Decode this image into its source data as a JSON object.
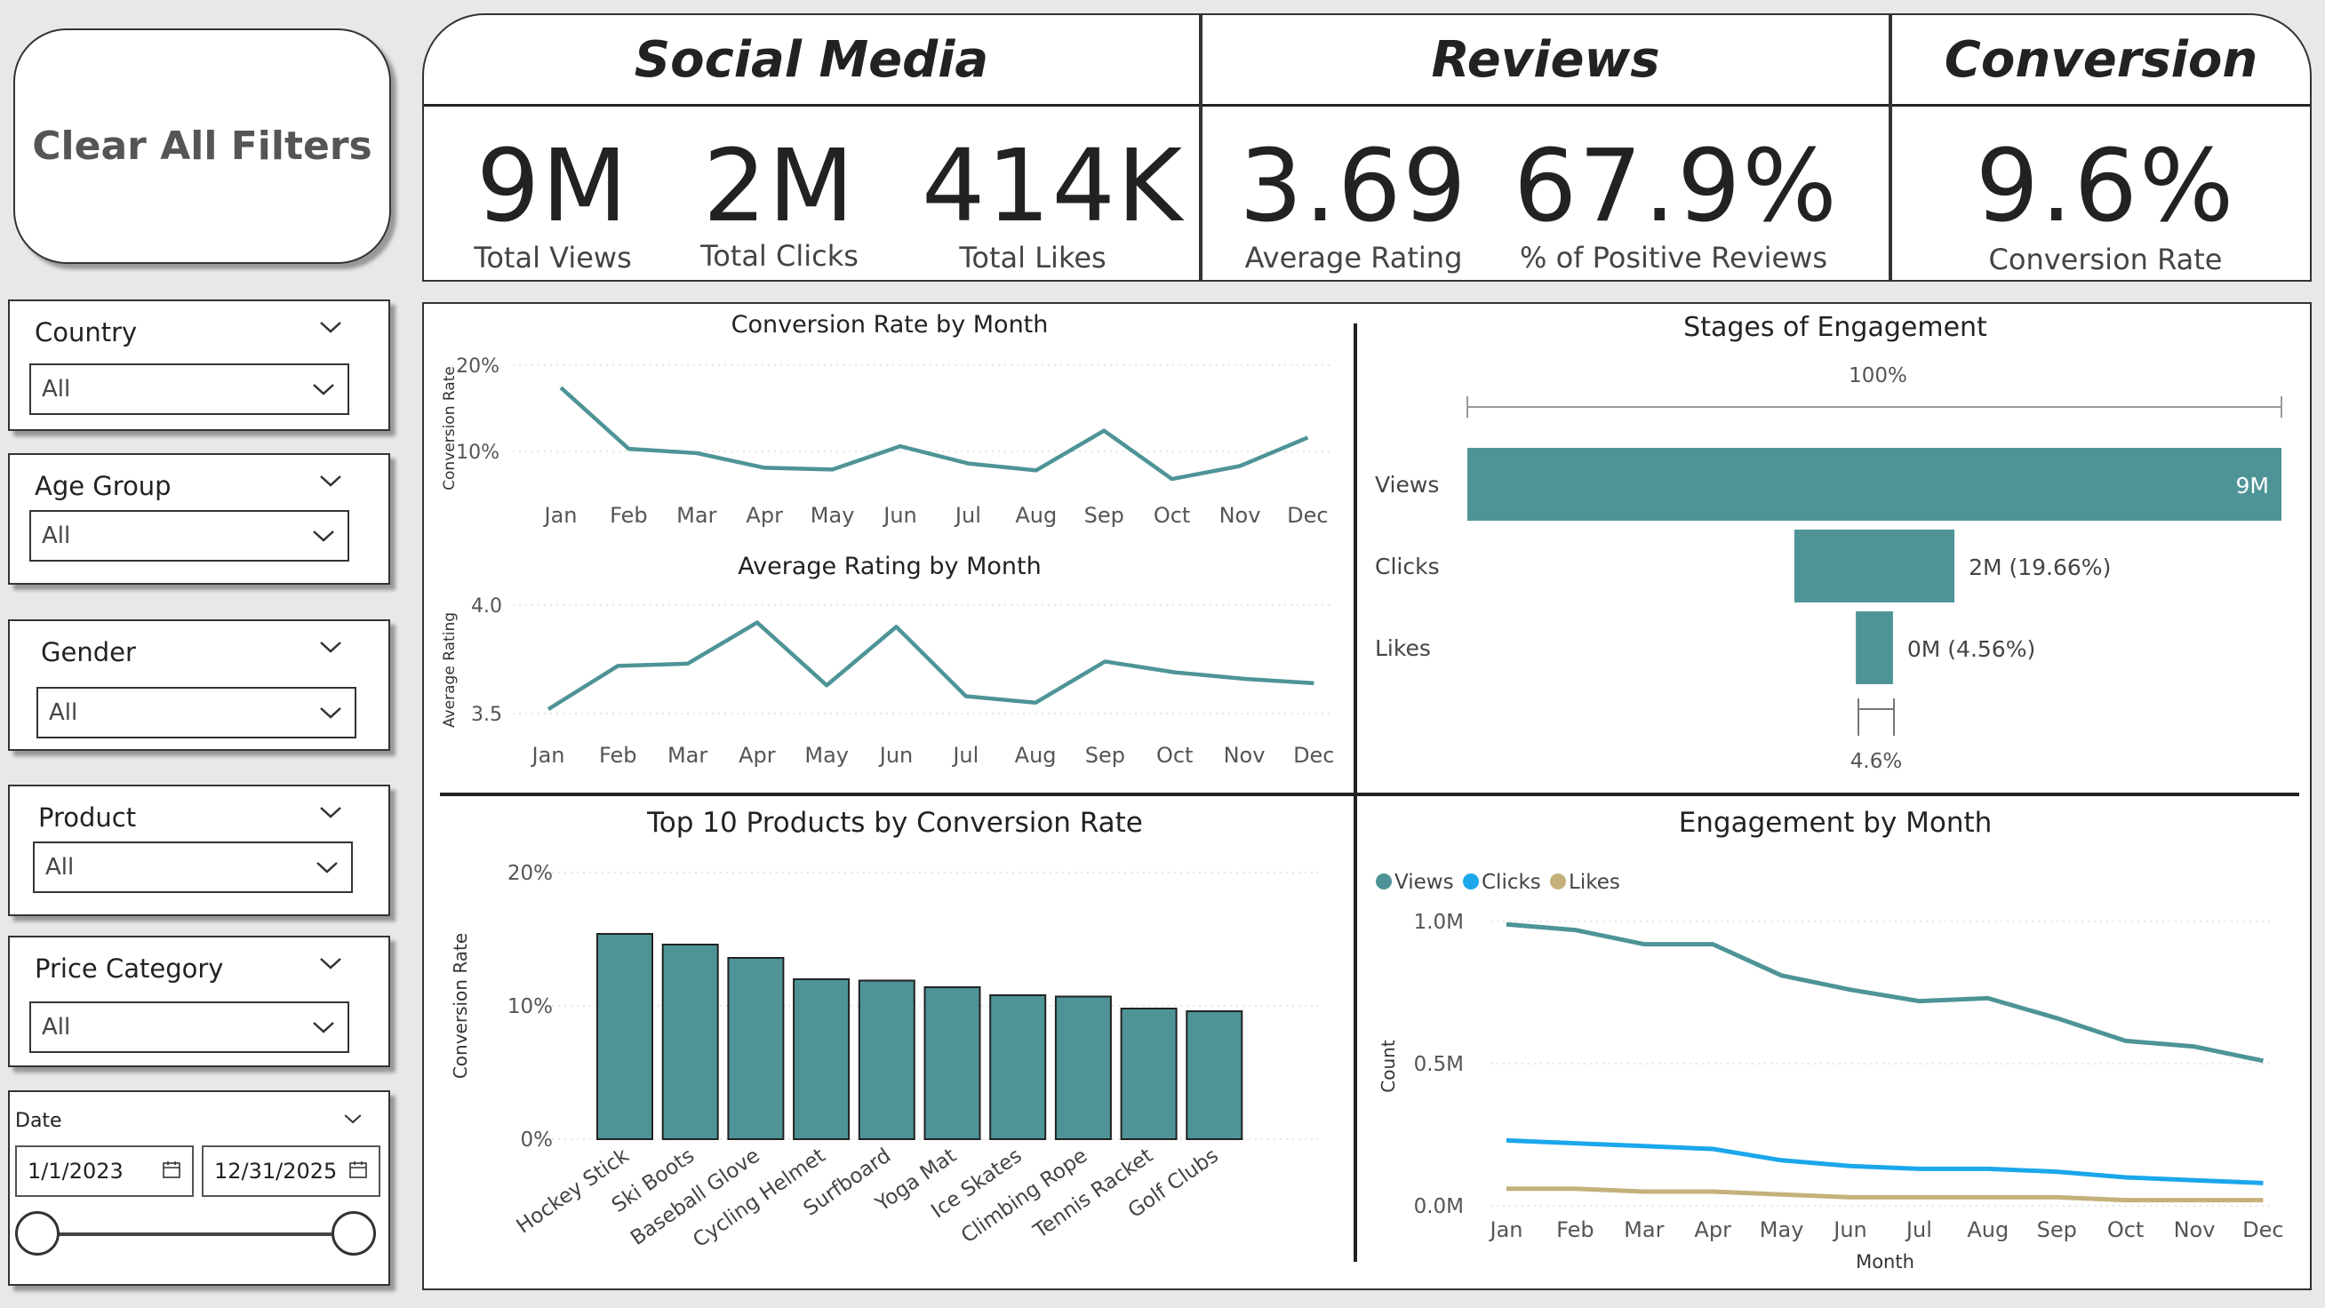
{
  "clear_button": {
    "label": "Clear All Filters"
  },
  "slicers": [
    {
      "title": "Country",
      "value": "All"
    },
    {
      "title": "Age Group",
      "value": "All"
    },
    {
      "title": "Gender",
      "value": "All"
    },
    {
      "title": "Product",
      "value": "All"
    },
    {
      "title": "Price Category",
      "value": "All"
    }
  ],
  "date_slicer": {
    "title": "Date",
    "start": "1/1/2023",
    "end": "12/31/2025"
  },
  "kpi": {
    "social_media": {
      "title": "Social Media",
      "items": [
        {
          "value": "9M",
          "label": "Total Views"
        },
        {
          "value": "2M",
          "label": "Total Clicks"
        },
        {
          "value": "414K",
          "label": "Total Likes"
        }
      ]
    },
    "reviews": {
      "title": "Reviews",
      "items": [
        {
          "value": "3.69",
          "label": "Average Rating"
        },
        {
          "value": "67.9%",
          "label": "% of Positive Reviews"
        }
      ]
    },
    "conversion": {
      "title": "Conversion",
      "items": [
        {
          "value": "9.6%",
          "label": "Conversion Rate"
        }
      ]
    }
  },
  "colors": {
    "teal": "#4e9497",
    "blue": "#1aa7ec",
    "tan": "#c4b07a"
  },
  "chart_data": [
    {
      "type": "line",
      "title": "Conversion Rate by Month",
      "ylabel": "Conversion Rate",
      "x": [
        "Jan",
        "Feb",
        "Mar",
        "Apr",
        "May",
        "Jun",
        "Jul",
        "Aug",
        "Sep",
        "Oct",
        "Nov",
        "Dec"
      ],
      "ticks": [
        "10%",
        "20%"
      ],
      "ylim": [
        0,
        20
      ],
      "values": [
        17.4,
        10.3,
        9.8,
        8.1,
        7.9,
        10.6,
        8.6,
        7.8,
        12.4,
        6.8,
        8.3,
        11.6
      ],
      "grid": true
    },
    {
      "type": "line",
      "title": "Average Rating by Month",
      "ylabel": "Average Rating",
      "x": [
        "Jan",
        "Feb",
        "Mar",
        "Apr",
        "May",
        "Jun",
        "Jul",
        "Aug",
        "Sep",
        "Oct",
        "Nov",
        "Dec"
      ],
      "ticks": [
        "3.5",
        "4.0"
      ],
      "ylim": [
        3.5,
        4.0
      ],
      "values": [
        3.52,
        3.72,
        3.73,
        3.92,
        3.63,
        3.9,
        3.58,
        3.55,
        3.74,
        3.69,
        3.66,
        3.64
      ],
      "grid": true
    },
    {
      "type": "bar",
      "title": "Stages of Engagement",
      "top_label": "100%",
      "bottom_label": "4.6%",
      "categories": [
        "Views",
        "Clicks",
        "Likes"
      ],
      "values": [
        9,
        1.77,
        0.41
      ],
      "data_labels": [
        "9M",
        "2M (19.66%)",
        "0M (4.56%)"
      ]
    },
    {
      "type": "bar",
      "title": "Top 10 Products by Conversion Rate",
      "ylabel": "Conversion Rate",
      "ticks": [
        "0%",
        "10%",
        "20%"
      ],
      "ylim": [
        0,
        20
      ],
      "categories": [
        "Hockey Stick",
        "Ski Boots",
        "Baseball Glove",
        "Cycling Helmet",
        "Surfboard",
        "Yoga Mat",
        "Ice Skates",
        "Climbing Rope",
        "Tennis Racket",
        "Golf Clubs"
      ],
      "values": [
        15.4,
        14.6,
        13.6,
        12.0,
        11.9,
        11.4,
        10.8,
        10.7,
        9.8,
        9.6
      ],
      "grid": true
    },
    {
      "type": "line",
      "title": "Engagement by Month",
      "xlabel": "Month",
      "ylabel": "Count",
      "x": [
        "Jan",
        "Feb",
        "Mar",
        "Apr",
        "May",
        "Jun",
        "Jul",
        "Aug",
        "Sep",
        "Oct",
        "Nov",
        "Dec"
      ],
      "ticks": [
        "0.0M",
        "0.5M",
        "1.0M"
      ],
      "ylim": [
        0,
        1.0
      ],
      "legend": "top-left",
      "grid": true,
      "series": [
        {
          "name": "Views",
          "values": [
            0.99,
            0.97,
            0.92,
            0.92,
            0.81,
            0.76,
            0.72,
            0.73,
            0.66,
            0.58,
            0.56,
            0.51
          ]
        },
        {
          "name": "Clicks",
          "values": [
            0.23,
            0.22,
            0.21,
            0.2,
            0.16,
            0.14,
            0.13,
            0.13,
            0.12,
            0.1,
            0.09,
            0.08
          ]
        },
        {
          "name": "Likes",
          "values": [
            0.06,
            0.06,
            0.05,
            0.05,
            0.04,
            0.03,
            0.03,
            0.03,
            0.03,
            0.02,
            0.02,
            0.02
          ]
        }
      ]
    }
  ]
}
